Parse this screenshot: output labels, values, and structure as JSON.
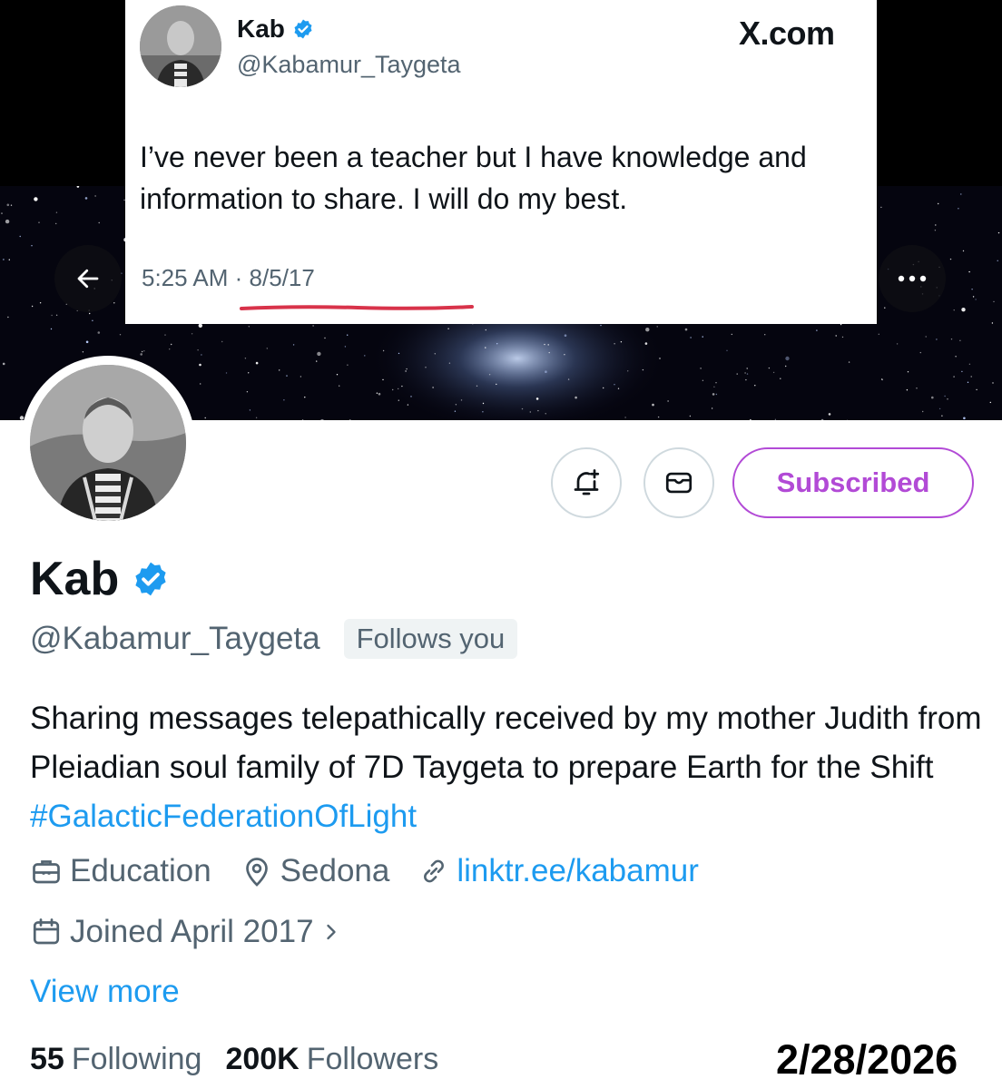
{
  "tweet": {
    "name": "Kab",
    "handle": "@Kabamur_Taygeta",
    "site": "X.com",
    "text": "I’ve never been a teacher but I have knowledge and information to share. I will do my best.",
    "time": "5:25 AM",
    "separator": "·",
    "date": "8/5/17"
  },
  "profile": {
    "name": "Kab",
    "handle": "@Kabamur_Taygeta",
    "follows_you": "Follows you",
    "subscribed_label": "Subscribed",
    "bio_text": "Sharing messages telepathically received by my mother Judith from Pleiadian soul family of 7D Taygeta to prepare Earth for the Shift ",
    "bio_hashtag": "#GalacticFederationOfLight",
    "category": "Education",
    "location": "Sedona",
    "link": "linktr.ee/kabamur",
    "joined": "Joined April 2017",
    "view_more": "View more",
    "following_count": "55",
    "following_label": "Following",
    "followers_count": "200K",
    "followers_label": "Followers"
  },
  "annotation_date": "2/28/2026",
  "icons": {
    "back": "arrow-left-icon",
    "more": "more-horizontal-icon",
    "verified": "verified-badge-icon",
    "notify": "bell-plus-icon",
    "message": "envelope-icon",
    "category": "briefcase-icon",
    "location": "location-pin-icon",
    "link": "link-icon",
    "calendar": "calendar-icon"
  },
  "colors": {
    "accent_blue": "#1d9bf0",
    "subscribed_purple": "#b24ad6",
    "underline_red": "#d8334a"
  }
}
